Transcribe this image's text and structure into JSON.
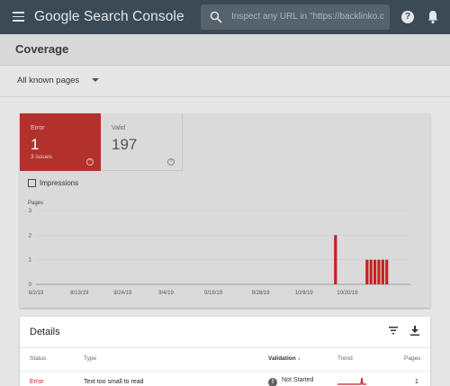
{
  "app": {
    "logo_text": "Google Search Console",
    "search_placeholder": "Inspect any URL in \"https://backlinko.c"
  },
  "page": {
    "title": "Coverage",
    "filter_label": "All known pages"
  },
  "summary": {
    "error": {
      "label": "Error",
      "count": "1",
      "sub": "3 issues"
    },
    "valid": {
      "label": "Valid",
      "count": "197"
    },
    "impressions_label": "Impressions"
  },
  "chart_data": {
    "type": "bar",
    "ylabel": "Pages",
    "ylim": [
      0,
      3
    ],
    "yticks": [
      "3",
      "2",
      "1",
      "0"
    ],
    "x_tick_labels": [
      "8/2/19",
      "8/13/19",
      "8/24/19",
      "9/4/19",
      "9/16/19",
      "9/28/19",
      "10/9/19",
      "10/20/19"
    ],
    "x_domain_days": [
      0,
      95
    ],
    "x_tick_days": [
      0,
      11,
      22,
      33,
      45,
      57,
      68,
      79
    ],
    "bars": [
      {
        "day": 76,
        "value": 2
      },
      {
        "day": 84,
        "value": 1
      },
      {
        "day": 85,
        "value": 1
      },
      {
        "day": 86,
        "value": 1
      },
      {
        "day": 87,
        "value": 1
      },
      {
        "day": 88,
        "value": 1
      },
      {
        "day": 89,
        "value": 1
      }
    ],
    "bar_color": "#c5221f",
    "grid": true
  },
  "details": {
    "title": "Details",
    "columns": {
      "status": "Status",
      "type": "Type",
      "validation": "Validation",
      "trend": "Trend",
      "pages": "Pages"
    },
    "rows": [
      {
        "status": "Error",
        "type": "Text too small to read",
        "validation": "Not Started",
        "pages": "1"
      }
    ]
  },
  "colors": {
    "topbar": "#3b4a55",
    "error_red": "#b3312c",
    "bar_red": "#c5221f"
  }
}
